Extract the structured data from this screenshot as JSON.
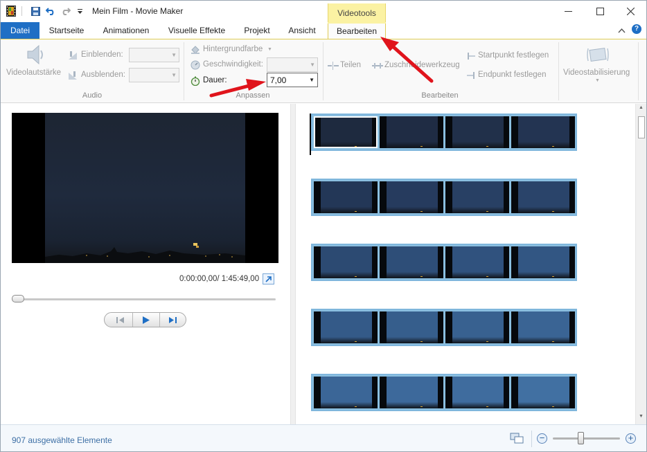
{
  "window": {
    "title": "Mein Film - Movie Maker",
    "minimize": "—",
    "maximize": "☐",
    "close": "✕"
  },
  "ribbon_tabs": {
    "context_group": "Videotools",
    "tabs": [
      "Datei",
      "Startseite",
      "Animationen",
      "Visuelle Effekte",
      "Projekt",
      "Ansicht",
      "Bearbeiten"
    ],
    "active": "Bearbeiten"
  },
  "audio_group": {
    "label": "Audio",
    "volume": "Videolautstärke",
    "fade_in": "Einblenden:",
    "fade_out": "Ausblenden:"
  },
  "adjust_group": {
    "label": "Anpassen",
    "background": "Hintergrundfarbe",
    "speed": "Geschwindigkeit:",
    "duration": "Dauer:",
    "duration_value": "7,00"
  },
  "edit_group": {
    "label": "Bearbeiten",
    "split": "Teilen",
    "trim": "Zuschneidewerkzeug",
    "set_start": "Startpunkt festlegen",
    "set_end": "Endpunkt festlegen"
  },
  "stabilize": {
    "label": "Videostabilisierung"
  },
  "preview": {
    "time": "0:00:00,00/ 1:45:49,00",
    "seek_fraction": 0
  },
  "storyboard": {
    "rows": 5,
    "frames_per_row": 4
  },
  "status": {
    "selection": "907 ausgewählte Elemente",
    "zoom_minus": "−",
    "zoom_plus": "+"
  },
  "colors": {
    "file_tab": "#1f6fc5",
    "context_tab": "#fbf2a3",
    "strip_border": "#7fb6dc",
    "annotation_arrow": "#e0141c"
  }
}
